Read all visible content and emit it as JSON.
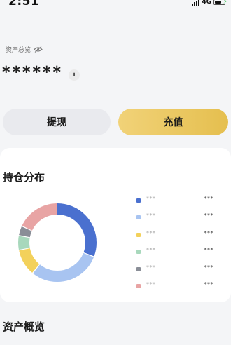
{
  "status_bar": {
    "time": "2:51",
    "network": "4G"
  },
  "asset": {
    "label": "资产总览",
    "balance_masked": "******",
    "info_icon": "i"
  },
  "buttons": {
    "withdraw": "提现",
    "recharge": "充值"
  },
  "holdings": {
    "title": "持仓分布"
  },
  "overview": {
    "title": "资产概览"
  },
  "colors": {
    "blue": "#4a70cf",
    "light_blue": "#a8c4f1",
    "yellow": "#f3d15b",
    "green": "#a8d8bc",
    "gray": "#8a8e97",
    "pink": "#e8a4a4",
    "gold": "#e8c35a"
  },
  "chart_data": {
    "type": "pie",
    "style": "donut",
    "legend_position": "right",
    "series": [
      {
        "name": "***",
        "value": "***",
        "fraction": 0.31,
        "color": "#4a70cf"
      },
      {
        "name": "***",
        "value": "***",
        "fraction": 0.3,
        "color": "#a8c4f1"
      },
      {
        "name": "***",
        "value": "***",
        "fraction": 0.11,
        "color": "#f3d15b"
      },
      {
        "name": "***",
        "value": "***",
        "fraction": 0.06,
        "color": "#a8d8bc"
      },
      {
        "name": "***",
        "value": "***",
        "fraction": 0.04,
        "color": "#8a8e97"
      },
      {
        "name": "***",
        "value": "***",
        "fraction": 0.18,
        "color": "#e8a4a4"
      }
    ]
  }
}
